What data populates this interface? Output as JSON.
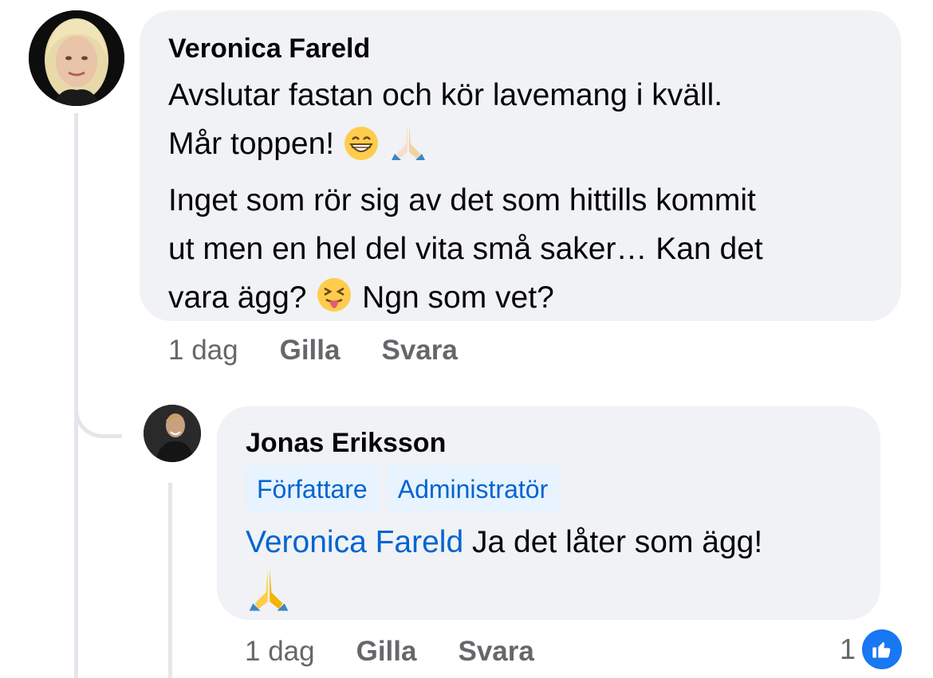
{
  "comment": {
    "author": "Veronica Fareld",
    "lines": [
      "Avslutar fastan och kör lavemang i kväll.",
      "Mår toppen!",
      "Inget som rör sig av det som hittills kommit",
      "ut men en hel del vita små saker… Kan det",
      "vara ägg?",
      "Ngn som vet?"
    ],
    "emojis": [
      "grinning-face",
      "folded-hands",
      "squinting-tongue-face"
    ],
    "time": "1 dag",
    "like_label": "Gilla",
    "reply_label": "Svara"
  },
  "reply": {
    "author": "Jonas Eriksson",
    "badges": [
      "Författare",
      "Administratör"
    ],
    "mention": "Veronica Fareld",
    "text": "Ja det låter som ägg!",
    "emoji": "folded-hands",
    "time": "1 dag",
    "like_label": "Gilla",
    "reply_label": "Svara",
    "reaction_count": "1",
    "reaction_icon": "thumbs-up-icon"
  },
  "colors": {
    "bubble": "#f0f2f5",
    "mention": "#0064d1",
    "badge_bg": "#e7f3ff",
    "meta": "#65676b",
    "like_blue": "#1877f2"
  }
}
